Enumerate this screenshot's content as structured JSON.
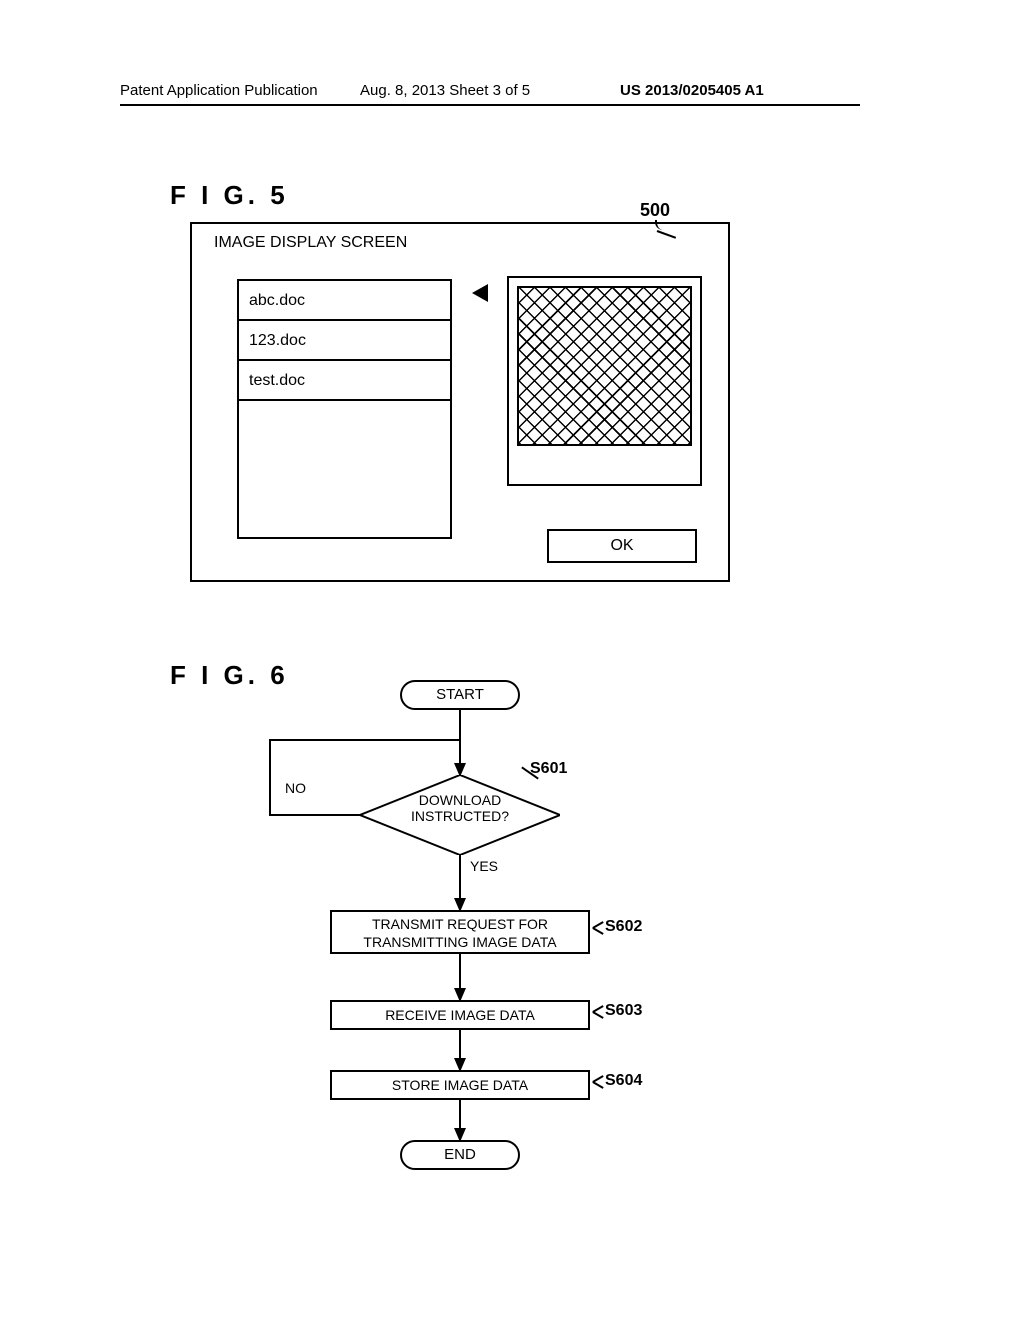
{
  "header": {
    "left": "Patent Application Publication",
    "middle": "Aug. 8, 2013  Sheet 3 of 5",
    "right": "US 2013/0205405 A1"
  },
  "fig5": {
    "label": "F I G.  5",
    "ref": "500",
    "screen_title": "IMAGE DISPLAY SCREEN",
    "files": [
      "abc.doc",
      "123.doc",
      "test.doc"
    ],
    "ok": "OK"
  },
  "fig6": {
    "label": "F I G.  6",
    "start": "START",
    "end": "END",
    "decision": "DOWNLOAD INSTRUCTED?",
    "no": "NO",
    "yes": "YES",
    "steps": {
      "s601": "S601",
      "s602": "S602",
      "s603": "S603",
      "s604": "S604"
    },
    "p602": "TRANSMIT REQUEST FOR TRANSMITTING IMAGE DATA",
    "p603": "RECEIVE IMAGE DATA",
    "p604": "STORE IMAGE DATA"
  }
}
